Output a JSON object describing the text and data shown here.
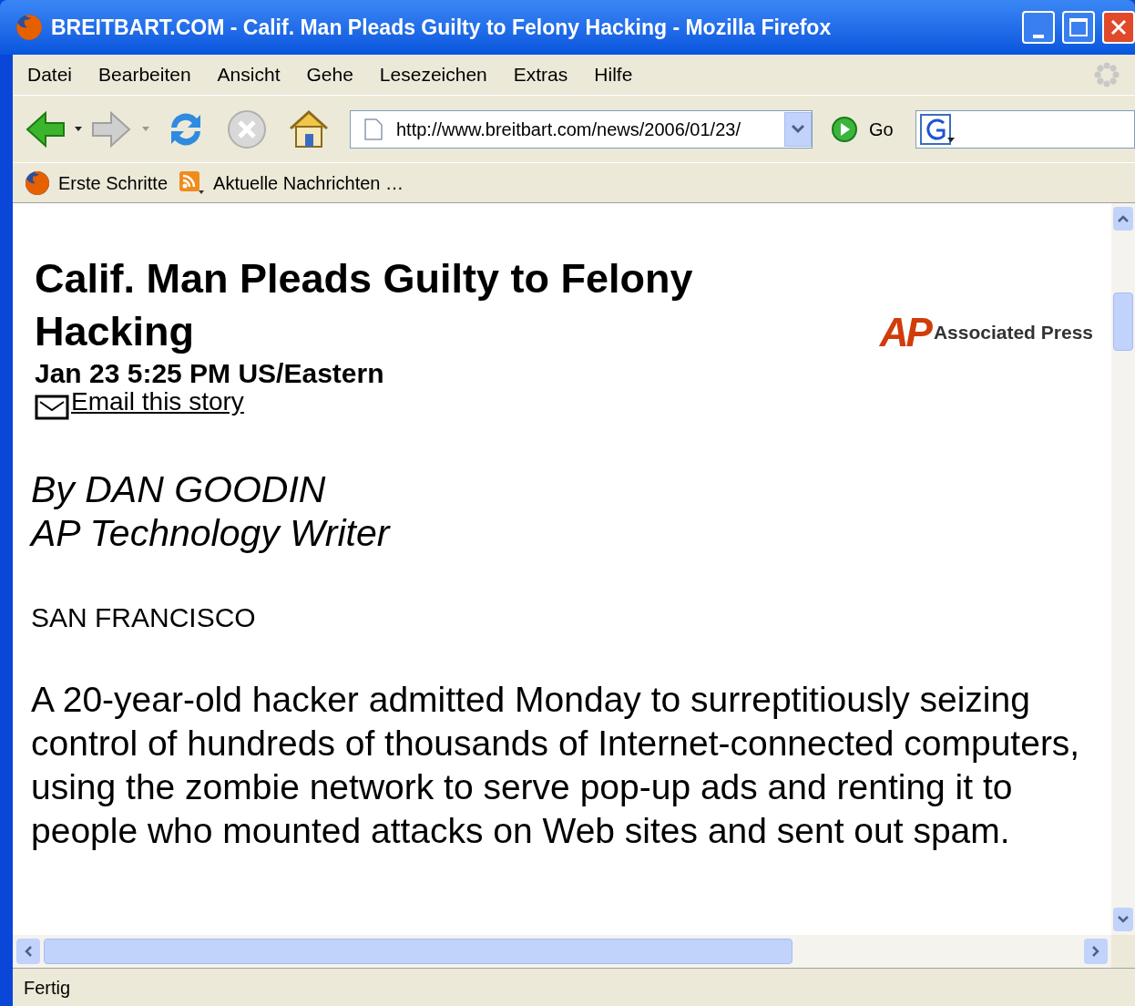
{
  "window": {
    "title": "BREITBART.COM - Calif. Man Pleads Guilty to Felony Hacking - Mozilla Firefox"
  },
  "menu": [
    "Datei",
    "Bearbeiten",
    "Ansicht",
    "Gehe",
    "Lesezeichen",
    "Extras",
    "Hilfe"
  ],
  "toolbar": {
    "url": "http://www.breitbart.com/news/2006/01/23/",
    "go": "Go"
  },
  "bookmarks": [
    {
      "label": "Erste Schritte",
      "kind": "firefox"
    },
    {
      "label": "Aktuelle Nachrichten …",
      "kind": "feed"
    }
  ],
  "article": {
    "headline": "Calif. Man Pleads Guilty to Felony Hacking",
    "date": "Jan 23 5:25 PM US/Eastern",
    "email_link": "Email this story",
    "logo_mark": "AP",
    "logo_text": "Associated Press",
    "byline": [
      "By DAN GOODIN",
      "AP Technology Writer"
    ],
    "dateline": "SAN FRANCISCO",
    "body": "A 20-year-old hacker admitted Monday to surreptitiously seizing control of hundreds of thousands of Internet-connected computers, using the zombie network to serve pop-up ads and renting it to people who mounted attacks on Web sites and sent out spam."
  },
  "status_bar": "Fertig"
}
